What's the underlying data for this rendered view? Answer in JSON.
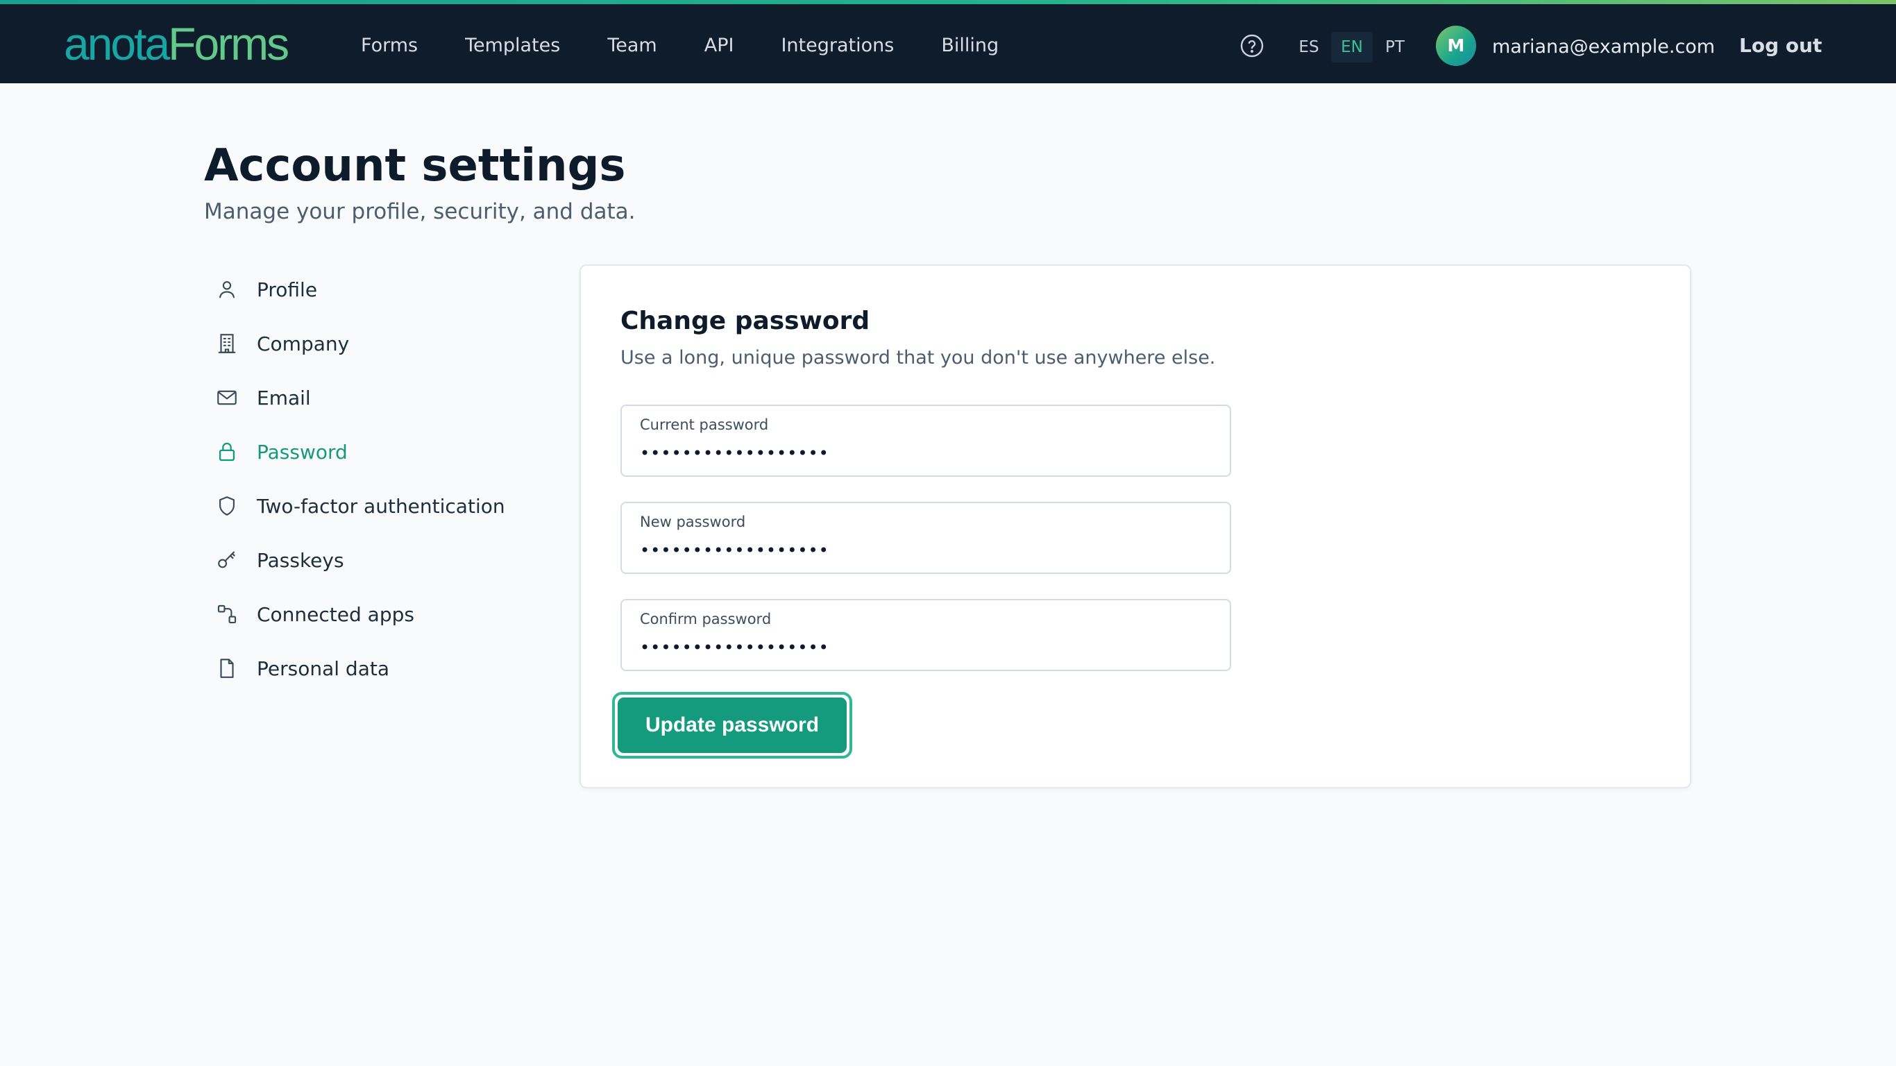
{
  "brand": {
    "logo_part1": "anota",
    "logo_part2": "Forms"
  },
  "nav": {
    "items": [
      {
        "label": "Forms"
      },
      {
        "label": "Templates"
      },
      {
        "label": "Team"
      },
      {
        "label": "API"
      },
      {
        "label": "Integrations"
      },
      {
        "label": "Billing"
      }
    ]
  },
  "header": {
    "help_icon": "help-circle-icon",
    "languages": {
      "es": "ES",
      "en": "EN",
      "pt": "PT",
      "active": "EN"
    },
    "user": {
      "avatar_initial": "M",
      "email": "mariana@example.com"
    },
    "logout_label": "Log out"
  },
  "page": {
    "title": "Account settings",
    "subtitle": "Manage your profile, security, and data."
  },
  "sidebar": {
    "items": [
      {
        "label": "Profile",
        "icon": "user-icon"
      },
      {
        "label": "Company",
        "icon": "building-icon"
      },
      {
        "label": "Email",
        "icon": "mail-icon"
      },
      {
        "label": "Password",
        "icon": "lock-icon",
        "active": true
      },
      {
        "label": "Two-factor authentication",
        "icon": "shield-icon"
      },
      {
        "label": "Passkeys",
        "icon": "key-icon"
      },
      {
        "label": "Connected apps",
        "icon": "connected-apps-icon"
      },
      {
        "label": "Personal data",
        "icon": "file-icon"
      }
    ]
  },
  "form": {
    "title": "Change password",
    "description": "Use a long, unique password that you don't use anywhere else.",
    "current": {
      "label": "Current password",
      "value": "••••••••••••••••••"
    },
    "new": {
      "label": "New password",
      "value": "••••••••••••••••••"
    },
    "confirm": {
      "label": "Confirm password",
      "value": "••••••••••••••••••"
    },
    "submit_label": "Update password"
  },
  "colors": {
    "topbar": "#0f1c2b",
    "accent": "#149a7d",
    "active_text": "#149a7a",
    "focus_ring": "#2fb894",
    "page_bg": "#f8fafb"
  }
}
